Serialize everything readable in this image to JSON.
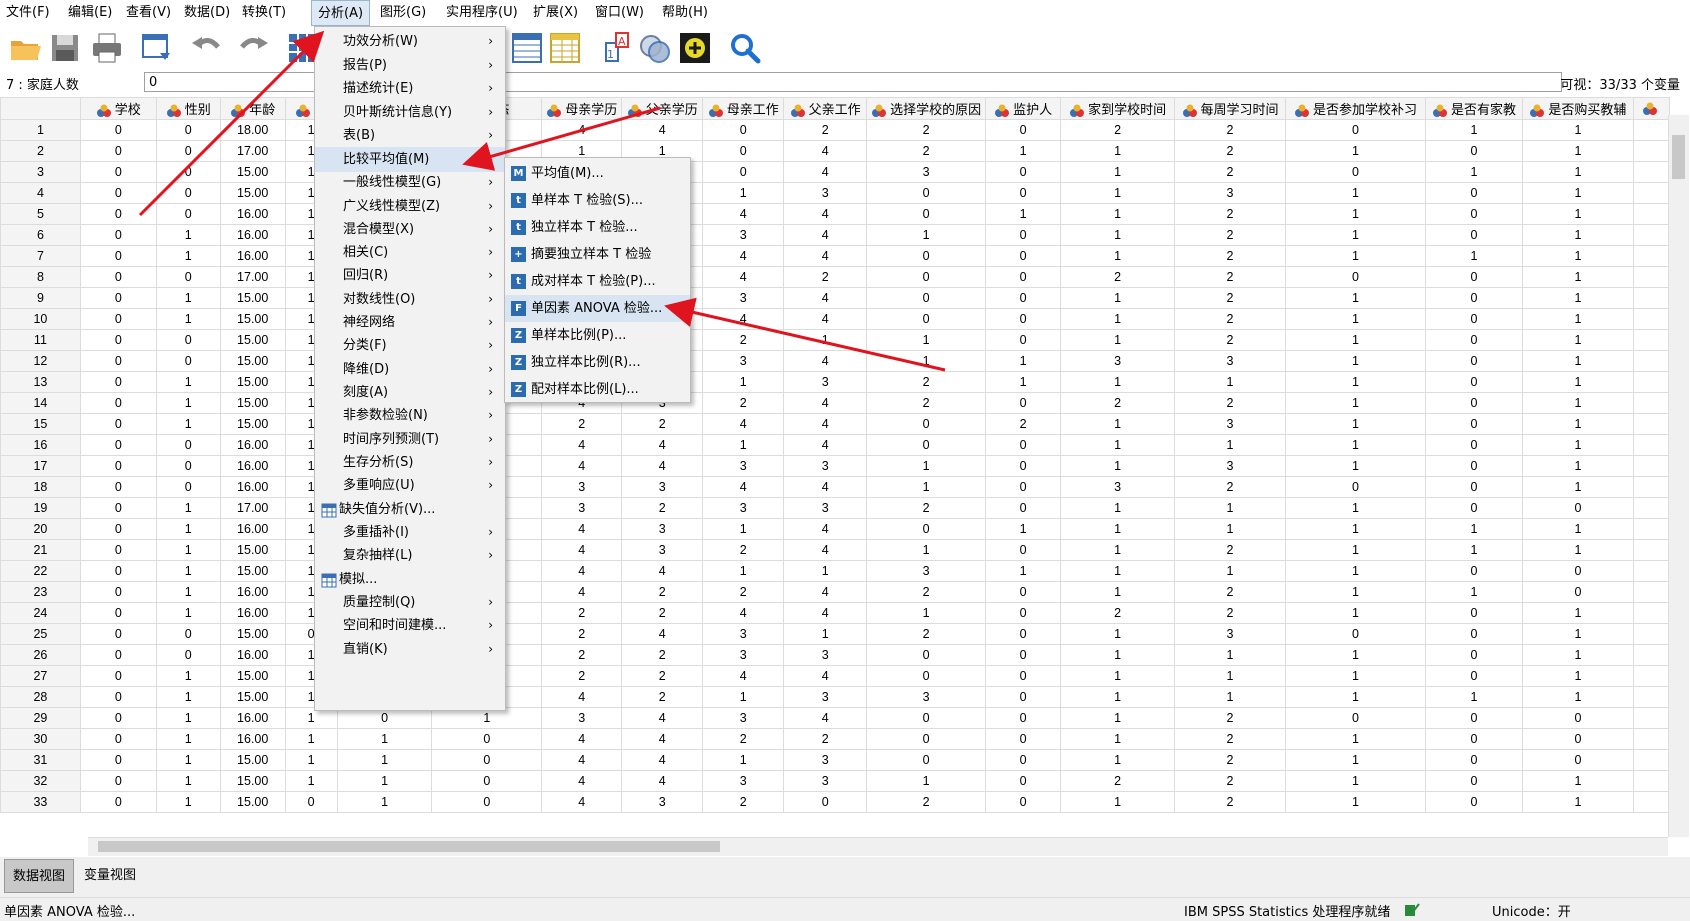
{
  "menubar": {
    "items": [
      "文件(F)",
      "编辑(E)",
      "查看(V)",
      "数据(D)",
      "转换(T)",
      "分析(A)",
      "图形(G)",
      "实用程序(U)",
      "扩展(X)",
      "窗口(W)",
      "帮助(H)"
    ],
    "active": "分析(A)"
  },
  "toolbar": {
    "icons": [
      "open-icon",
      "save-icon",
      "print-icon",
      "dialog-recall-icon",
      "undo-icon",
      "redo-icon",
      "goto-case-icon",
      "goto-variable-icon",
      "variables-icon",
      "split-file-icon",
      "weight-cases-icon",
      "value-labels-icon",
      "use-sets-icon",
      "add-icon",
      "search-icon"
    ]
  },
  "cellbar": {
    "ref": "7 : 家庭人数",
    "value": "0",
    "visible": "可视：33/33 个变量"
  },
  "columns": [
    "学校",
    "性别",
    "年龄",
    "户",
    "",
    "状态",
    "母亲学历",
    "父亲学历",
    "母亲工作",
    "父亲工作",
    "选择学校的原因",
    "监护人",
    "家到学校时间",
    "每周学习时间",
    "是否参加学校补习",
    "是否有家教",
    "是否购买教辅",
    ""
  ],
  "rows": [
    {
      "n": "1",
      "v": [
        "0",
        "0",
        "18.00",
        "1",
        "",
        "",
        "4",
        "4",
        "0",
        "2",
        "2",
        "0",
        "2",
        "2",
        "0",
        "1",
        "1"
      ]
    },
    {
      "n": "2",
      "v": [
        "0",
        "0",
        "17.00",
        "1",
        "",
        "",
        "1",
        "1",
        "0",
        "4",
        "2",
        "1",
        "1",
        "2",
        "1",
        "0",
        "1"
      ]
    },
    {
      "n": "3",
      "v": [
        "0",
        "0",
        "15.00",
        "1",
        "",
        "",
        "",
        "",
        "0",
        "4",
        "3",
        "0",
        "1",
        "2",
        "0",
        "1",
        "1"
      ]
    },
    {
      "n": "4",
      "v": [
        "0",
        "0",
        "15.00",
        "1",
        "",
        "",
        "",
        "",
        "1",
        "3",
        "0",
        "0",
        "1",
        "3",
        "1",
        "0",
        "1"
      ]
    },
    {
      "n": "5",
      "v": [
        "0",
        "0",
        "16.00",
        "1",
        "",
        "",
        "",
        "",
        "4",
        "4",
        "0",
        "1",
        "1",
        "2",
        "1",
        "0",
        "1"
      ]
    },
    {
      "n": "6",
      "v": [
        "0",
        "1",
        "16.00",
        "1",
        "",
        "",
        "",
        "",
        "3",
        "4",
        "1",
        "0",
        "1",
        "2",
        "1",
        "0",
        "1"
      ]
    },
    {
      "n": "7",
      "v": [
        "0",
        "1",
        "16.00",
        "1",
        "",
        "",
        "",
        "",
        "4",
        "4",
        "0",
        "0",
        "1",
        "2",
        "1",
        "1",
        "1"
      ]
    },
    {
      "n": "8",
      "v": [
        "0",
        "0",
        "17.00",
        "1",
        "",
        "",
        "",
        "",
        "4",
        "2",
        "0",
        "0",
        "2",
        "2",
        "0",
        "0",
        "1"
      ]
    },
    {
      "n": "9",
      "v": [
        "0",
        "1",
        "15.00",
        "1",
        "",
        "",
        "",
        "",
        "3",
        "4",
        "0",
        "0",
        "1",
        "2",
        "1",
        "0",
        "1"
      ]
    },
    {
      "n": "10",
      "v": [
        "0",
        "1",
        "15.00",
        "1",
        "",
        "",
        "",
        "",
        "4",
        "4",
        "0",
        "0",
        "1",
        "2",
        "1",
        "0",
        "1"
      ]
    },
    {
      "n": "11",
      "v": [
        "0",
        "0",
        "15.00",
        "1",
        "",
        "",
        "",
        "",
        "2",
        "1",
        "1",
        "0",
        "1",
        "2",
        "1",
        "0",
        "1"
      ]
    },
    {
      "n": "12",
      "v": [
        "0",
        "0",
        "15.00",
        "1",
        "",
        "",
        "",
        "",
        "3",
        "4",
        "1",
        "1",
        "3",
        "3",
        "1",
        "0",
        "1"
      ]
    },
    {
      "n": "13",
      "v": [
        "0",
        "1",
        "15.00",
        "1",
        "",
        "",
        "",
        "",
        "1",
        "3",
        "2",
        "1",
        "1",
        "1",
        "1",
        "0",
        "1"
      ]
    },
    {
      "n": "14",
      "v": [
        "0",
        "1",
        "15.00",
        "1",
        "",
        "",
        "4",
        "3",
        "2",
        "4",
        "2",
        "0",
        "2",
        "2",
        "1",
        "0",
        "1"
      ]
    },
    {
      "n": "15",
      "v": [
        "0",
        "1",
        "15.00",
        "1",
        "",
        "",
        "2",
        "2",
        "4",
        "4",
        "0",
        "2",
        "1",
        "3",
        "1",
        "0",
        "1"
      ]
    },
    {
      "n": "16",
      "v": [
        "0",
        "0",
        "16.00",
        "1",
        "",
        "",
        "4",
        "4",
        "1",
        "4",
        "0",
        "0",
        "1",
        "1",
        "1",
        "0",
        "1"
      ]
    },
    {
      "n": "17",
      "v": [
        "0",
        "0",
        "16.00",
        "1",
        "",
        "",
        "4",
        "4",
        "3",
        "3",
        "1",
        "0",
        "1",
        "3",
        "1",
        "0",
        "1"
      ]
    },
    {
      "n": "18",
      "v": [
        "0",
        "0",
        "16.00",
        "1",
        "",
        "",
        "3",
        "3",
        "4",
        "4",
        "1",
        "0",
        "3",
        "2",
        "0",
        "0",
        "1"
      ]
    },
    {
      "n": "19",
      "v": [
        "0",
        "1",
        "17.00",
        "1",
        "",
        "",
        "3",
        "2",
        "3",
        "3",
        "2",
        "0",
        "1",
        "1",
        "1",
        "0",
        "0"
      ]
    },
    {
      "n": "20",
      "v": [
        "0",
        "1",
        "16.00",
        "1",
        "",
        "",
        "4",
        "3",
        "1",
        "4",
        "0",
        "1",
        "1",
        "1",
        "1",
        "1",
        "1"
      ]
    },
    {
      "n": "21",
      "v": [
        "0",
        "1",
        "15.00",
        "1",
        "",
        "",
        "4",
        "3",
        "2",
        "4",
        "1",
        "0",
        "1",
        "2",
        "1",
        "1",
        "1"
      ]
    },
    {
      "n": "22",
      "v": [
        "0",
        "1",
        "15.00",
        "1",
        "",
        "",
        "4",
        "4",
        "1",
        "1",
        "3",
        "1",
        "1",
        "1",
        "1",
        "0",
        "0"
      ]
    },
    {
      "n": "23",
      "v": [
        "0",
        "1",
        "16.00",
        "1",
        "",
        "",
        "4",
        "2",
        "2",
        "4",
        "2",
        "0",
        "1",
        "2",
        "1",
        "1",
        "0"
      ]
    },
    {
      "n": "24",
      "v": [
        "0",
        "1",
        "16.00",
        "1",
        "",
        "",
        "2",
        "2",
        "4",
        "4",
        "1",
        "0",
        "2",
        "2",
        "1",
        "0",
        "1"
      ]
    },
    {
      "n": "25",
      "v": [
        "0",
        "0",
        "15.00",
        "0",
        "",
        "",
        "2",
        "4",
        "3",
        "1",
        "2",
        "0",
        "1",
        "3",
        "0",
        "0",
        "1"
      ]
    },
    {
      "n": "26",
      "v": [
        "0",
        "0",
        "16.00",
        "1",
        "",
        "",
        "2",
        "2",
        "3",
        "3",
        "0",
        "0",
        "1",
        "1",
        "1",
        "0",
        "1"
      ]
    },
    {
      "n": "27",
      "v": [
        "0",
        "1",
        "15.00",
        "1",
        "",
        "",
        "2",
        "2",
        "4",
        "4",
        "0",
        "0",
        "1",
        "1",
        "1",
        "0",
        "1"
      ]
    },
    {
      "n": "28",
      "v": [
        "0",
        "1",
        "15.00",
        "1",
        "1",
        "0",
        "4",
        "2",
        "1",
        "3",
        "3",
        "0",
        "1",
        "1",
        "1",
        "1",
        "1"
      ]
    },
    {
      "n": "29",
      "v": [
        "0",
        "1",
        "16.00",
        "1",
        "0",
        "1",
        "3",
        "4",
        "3",
        "4",
        "0",
        "0",
        "1",
        "2",
        "0",
        "0",
        "0"
      ]
    },
    {
      "n": "30",
      "v": [
        "0",
        "1",
        "16.00",
        "1",
        "1",
        "0",
        "4",
        "4",
        "2",
        "2",
        "0",
        "0",
        "1",
        "2",
        "1",
        "0",
        "0"
      ]
    },
    {
      "n": "31",
      "v": [
        "0",
        "1",
        "15.00",
        "1",
        "1",
        "0",
        "4",
        "4",
        "1",
        "3",
        "0",
        "0",
        "1",
        "2",
        "1",
        "0",
        "0"
      ]
    },
    {
      "n": "32",
      "v": [
        "0",
        "1",
        "15.00",
        "1",
        "1",
        "0",
        "4",
        "4",
        "3",
        "3",
        "1",
        "0",
        "2",
        "2",
        "1",
        "0",
        "1"
      ]
    },
    {
      "n": "33",
      "v": [
        "0",
        "1",
        "15.00",
        "0",
        "1",
        "0",
        "4",
        "3",
        "2",
        "0",
        "2",
        "0",
        "1",
        "2",
        "1",
        "0",
        "1"
      ]
    }
  ],
  "analyze_menu": [
    {
      "label": "功效分析(W)",
      "sub": true
    },
    {
      "label": "报告(P)",
      "sub": true
    },
    {
      "label": "描述统计(E)",
      "sub": true
    },
    {
      "label": "贝叶斯统计信息(Y)",
      "sub": true
    },
    {
      "label": "表(B)",
      "sub": true
    },
    {
      "label": "比较平均值(M)",
      "sub": true
    },
    {
      "label": "一般线性模型(G)",
      "sub": true
    },
    {
      "label": "广义线性模型(Z)",
      "sub": true
    },
    {
      "label": "混合模型(X)",
      "sub": true
    },
    {
      "label": "相关(C)",
      "sub": true
    },
    {
      "label": "回归(R)",
      "sub": true
    },
    {
      "label": "对数线性(O)",
      "sub": true
    },
    {
      "label": "神经网络",
      "sub": true
    },
    {
      "label": "分类(F)",
      "sub": true
    },
    {
      "label": "降维(D)",
      "sub": true
    },
    {
      "label": "刻度(A)",
      "sub": true
    },
    {
      "label": "非参数检验(N)",
      "sub": true
    },
    {
      "label": "时间序列预测(T)",
      "sub": true
    },
    {
      "label": "生存分析(S)",
      "sub": true
    },
    {
      "label": "多重响应(U)",
      "sub": true
    },
    {
      "label": "缺失值分析(V)...",
      "sub": false
    },
    {
      "label": "多重插补(I)",
      "sub": true
    },
    {
      "label": "复杂抽样(L)",
      "sub": true
    },
    {
      "label": "模拟...",
      "sub": false
    },
    {
      "label": "质量控制(Q)",
      "sub": true
    },
    {
      "label": "空间和时间建模...",
      "sub": true
    },
    {
      "label": "直销(K)",
      "sub": true
    }
  ],
  "compare_means_submenu": [
    {
      "label": "平均值(M)...",
      "icon": "M"
    },
    {
      "label": "单样本 T 检验(S)...",
      "icon": "t"
    },
    {
      "label": "独立样本 T 检验...",
      "icon": "t"
    },
    {
      "label": "摘要独立样本 T 检验",
      "icon": "+"
    },
    {
      "label": "成对样本 T 检验(P)...",
      "icon": "t"
    },
    {
      "label": "单因素 ANOVA 检验...",
      "icon": "F"
    },
    {
      "label": "单样本比例(P)...",
      "icon": "Z"
    },
    {
      "label": "独立样本比例(R)...",
      "icon": "Z"
    },
    {
      "label": "配对样本比例(L)...",
      "icon": "Z"
    }
  ],
  "tabs": [
    "数据视图",
    "变量视图"
  ],
  "status": {
    "left": "单因素 ANOVA 检验...",
    "processor": "IBM SPSS Statistics 处理程序就绪",
    "unicode": "Unicode：开"
  },
  "colors": {
    "arrow": "#e0141e",
    "highlight": "#d8e4f2"
  }
}
